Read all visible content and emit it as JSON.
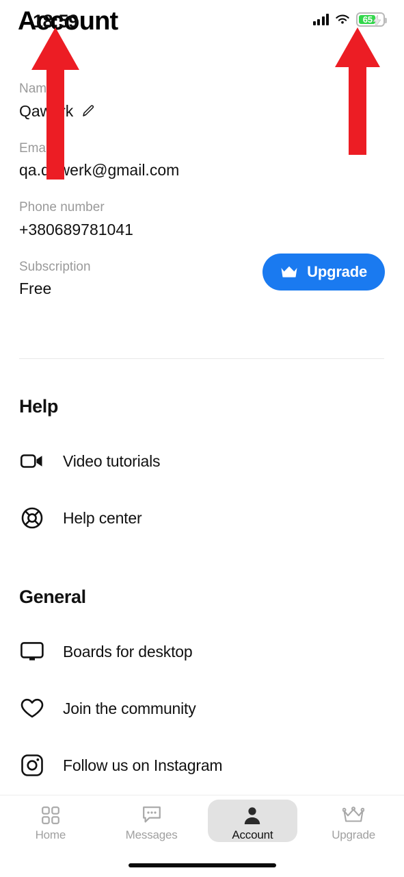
{
  "status_bar": {
    "time": "18:59",
    "signal_icon": "cellular-signal-icon",
    "wifi_icon": "wifi-icon",
    "battery_percent": "65",
    "battery_icon": "battery-charging-icon",
    "battery_color": "#32d74b"
  },
  "header": {
    "title": "Account"
  },
  "profile": {
    "name_label": "Name",
    "name_value": "Qawerk",
    "edit_icon": "pencil-edit-icon",
    "email_label": "Email",
    "email_value": "qa.qawerk@gmail.com",
    "phone_label": "Phone number",
    "phone_value": "+380689781041",
    "subscription_label": "Subscription",
    "subscription_value": "Free",
    "upgrade_button_label": "Upgrade",
    "upgrade_button_icon": "crown-icon",
    "upgrade_button_color": "#1a7af0"
  },
  "sections": [
    {
      "title": "Help",
      "items": [
        {
          "label": "Video tutorials",
          "icon": "video-camera-icon"
        },
        {
          "label": "Help center",
          "icon": "lifebuoy-icon"
        }
      ]
    },
    {
      "title": "General",
      "items": [
        {
          "label": "Boards for desktop",
          "icon": "desktop-monitor-icon"
        },
        {
          "label": "Join the community",
          "icon": "heart-icon"
        },
        {
          "label": "Follow us on Instagram",
          "icon": "instagram-icon"
        }
      ]
    }
  ],
  "bottom_nav": {
    "items": [
      {
        "label": "Home",
        "icon": "grid-icon",
        "active": false
      },
      {
        "label": "Messages",
        "icon": "chat-bubble-icon",
        "active": false
      },
      {
        "label": "Account",
        "icon": "person-icon",
        "active": true
      },
      {
        "label": "Upgrade",
        "icon": "crown-outline-icon",
        "active": false
      }
    ]
  },
  "annotations": {
    "arrow_color": "#ec1d24",
    "arrows": [
      {
        "name": "arrow-pointing-to-status-time",
        "target": "time"
      },
      {
        "name": "arrow-pointing-to-battery-status",
        "target": "battery"
      }
    ]
  }
}
